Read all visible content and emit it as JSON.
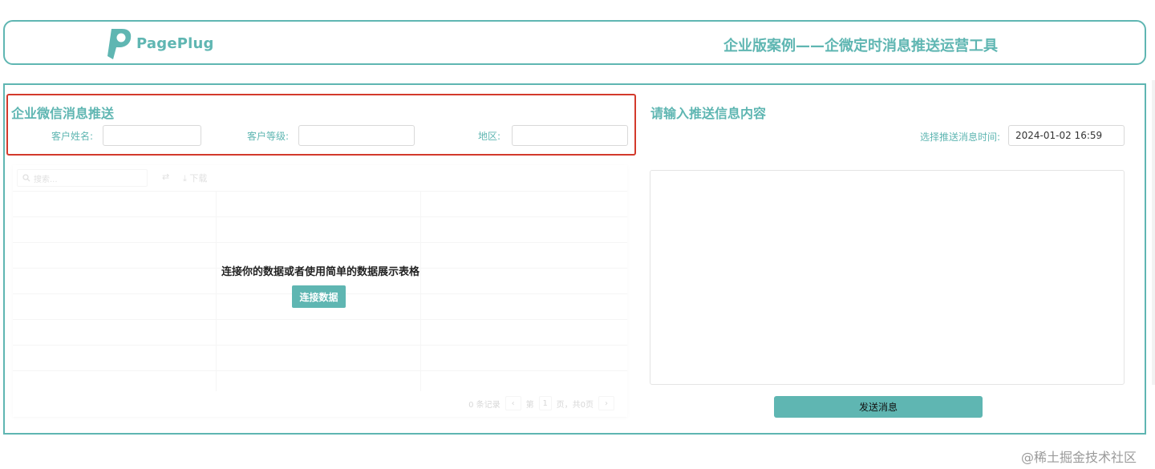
{
  "header": {
    "logo_text": "PagePlug",
    "title": "企业版案例——企微定时消息推送运营工具"
  },
  "left_section": {
    "title": "企业微信消息推送",
    "fields": [
      {
        "label": "客户姓名:",
        "value": ""
      },
      {
        "label": "客户等级:",
        "value": ""
      },
      {
        "label": "地区:",
        "value": ""
      }
    ]
  },
  "table": {
    "search_placeholder": "搜索...",
    "download_label": "下载",
    "empty_message": "连接你的数据或者使用简单的数据展示表格",
    "connect_button": "连接数据",
    "pager": {
      "records": "0 条记录",
      "page_prefix": "第",
      "page_number": "1",
      "page_suffix": "页，共0页"
    }
  },
  "right_section": {
    "title": "请输入推送信息内容",
    "time_label": "选择推送消息时间:",
    "time_value": "2024-01-02 16:59",
    "message_value": "",
    "send_button": "发送消息"
  },
  "watermark": "@稀土掘金技术社区",
  "colors": {
    "accent": "#5fb6b2",
    "highlight_border": "#d33a2c"
  }
}
